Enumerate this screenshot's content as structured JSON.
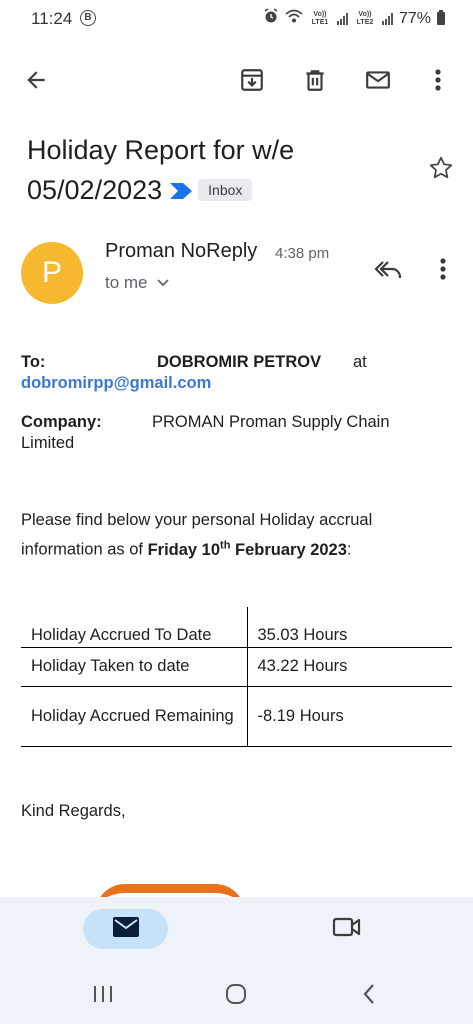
{
  "status_bar": {
    "time": "11:24",
    "b_glyph": "B",
    "lte1": "Vo)) LTE1",
    "lte2": "Vo)) LTE2",
    "battery": "77%"
  },
  "toolbar": {
    "icons": [
      "back-arrow-icon",
      "archive-icon",
      "delete-icon",
      "mark-unread-icon",
      "more-vert-icon"
    ]
  },
  "email": {
    "subject_line1": "Holiday Report for w/e",
    "subject_line2": "05/02/2023",
    "label": "Inbox",
    "label_color": "#1a73e8",
    "sender": {
      "initial": "P",
      "avatar_color": "#f5b82e",
      "name": "Proman NoReply",
      "time": "4:38 pm",
      "recipient": "to me"
    },
    "body": {
      "to_label": "To:",
      "to_name": "DOBROMIR PETROV",
      "to_at": "at",
      "to_email": "dobromirpp@gmail.com",
      "company_label": "Company:",
      "company_value": "PROMAN Proman Supply Chain Limited",
      "intro_text": "Please find below your personal Holiday accrual information as of ",
      "intro_date_pre": "Friday 10",
      "intro_date_sup": "th",
      "intro_date_post": " February 2023",
      "intro_end": ":",
      "table": [
        {
          "label": "Holiday Accrued To Date",
          "value": "35.03 Hours"
        },
        {
          "label": "Holiday Taken to date",
          "value": "43.22 Hours"
        },
        {
          "label": "Holiday Accrued Remaining",
          "value": "-8.19 Hours"
        }
      ],
      "closing": "Kind Regards,"
    }
  },
  "bottom_nav": {
    "items": [
      "mail-icon",
      "meet-video-icon"
    ],
    "active_color": "#c6e2f9"
  },
  "system_nav": [
    "recents-icon",
    "home-icon",
    "back-icon"
  ]
}
